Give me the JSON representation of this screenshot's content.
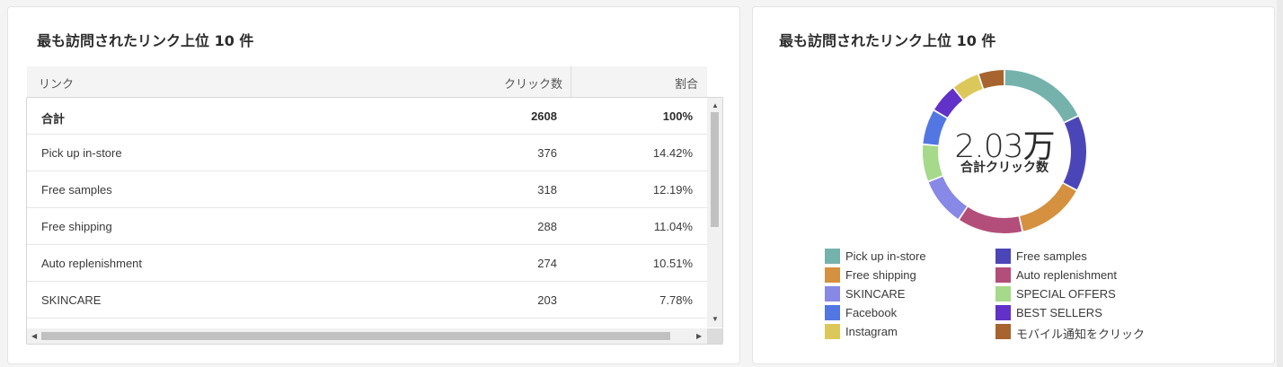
{
  "table_card": {
    "title": "最も訪問されたリンク上位 10 件",
    "columns": {
      "link": "リンク",
      "clicks": "クリック数",
      "ratio": "割合"
    },
    "total": {
      "link": "合計",
      "clicks": "2608",
      "ratio": "100%"
    },
    "rows": [
      {
        "link": "Pick up in-store",
        "clicks": "376",
        "ratio": "14.42%"
      },
      {
        "link": "Free samples",
        "clicks": "318",
        "ratio": "12.19%"
      },
      {
        "link": "Free shipping",
        "clicks": "288",
        "ratio": "11.04%"
      },
      {
        "link": "Auto replenishment",
        "clicks": "274",
        "ratio": "10.51%"
      },
      {
        "link": "SKINCARE",
        "clicks": "203",
        "ratio": "7.78%"
      }
    ],
    "scroll_icons": {
      "up": "▲",
      "down": "▼",
      "left": "◀",
      "right": "▶"
    }
  },
  "chart_card": {
    "title": "最も訪問されたリンク上位 10 件",
    "center_value": "2.03万",
    "center_label": "合計クリック数"
  },
  "chart_data": {
    "type": "pie",
    "title": "最も訪問されたリンク上位 10 件",
    "donut": true,
    "center_value": "2.03万",
    "center_label": "合計クリック数",
    "slices": [
      {
        "label": "Pick up in-store",
        "value": 14.42,
        "color": "#75b2ac"
      },
      {
        "label": "Free samples",
        "value": 12.19,
        "color": "#4b46b8"
      },
      {
        "label": "Free shipping",
        "value": 11.04,
        "color": "#d5913f"
      },
      {
        "label": "Auto replenishment",
        "value": 10.51,
        "color": "#b34e7a"
      },
      {
        "label": "SKINCARE",
        "value": 7.78,
        "color": "#8888e6"
      },
      {
        "label": "SPECIAL OFFERS",
        "value": 6.0,
        "color": "#a6d98a"
      },
      {
        "label": "Facebook",
        "value": 5.7,
        "color": "#5277e2"
      },
      {
        "label": "BEST SELLERS",
        "value": 4.7,
        "color": "#6131c8"
      },
      {
        "label": "Instagram",
        "value": 4.5,
        "color": "#dcc85a"
      },
      {
        "label": "モバイル通知をクリック",
        "value": 4.2,
        "color": "#a7642e"
      }
    ],
    "legend_position": "bottom"
  }
}
